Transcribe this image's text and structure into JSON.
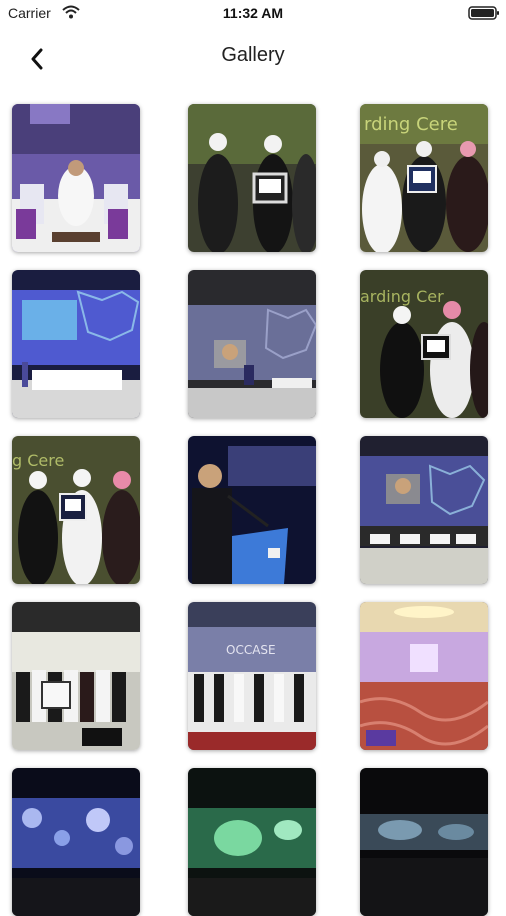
{
  "status_bar": {
    "carrier": "Carrier",
    "time": "11:32 AM"
  },
  "nav": {
    "title": "Gallery"
  },
  "gallery": [
    {
      "id": "ceremony-1"
    },
    {
      "id": "award-1"
    },
    {
      "id": "award-2"
    },
    {
      "id": "stage-1"
    },
    {
      "id": "stage-2"
    },
    {
      "id": "award-3"
    },
    {
      "id": "award-4"
    },
    {
      "id": "speaker"
    },
    {
      "id": "panel"
    },
    {
      "id": "group-1"
    },
    {
      "id": "group-2"
    },
    {
      "id": "ballroom"
    },
    {
      "id": "screen-1"
    },
    {
      "id": "screen-2"
    },
    {
      "id": "screen-3"
    }
  ]
}
